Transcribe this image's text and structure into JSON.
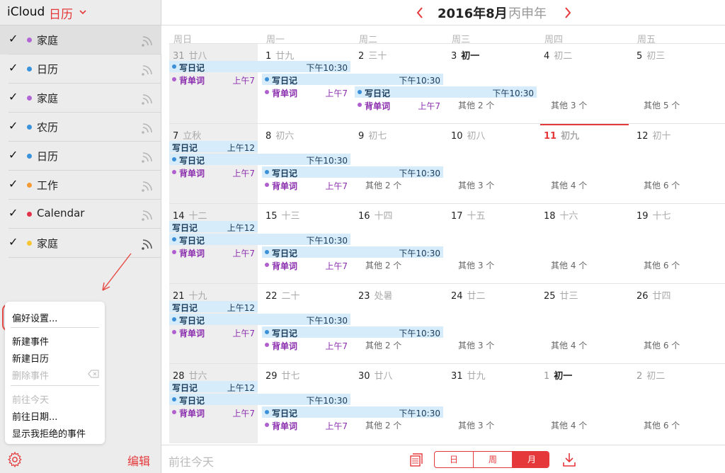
{
  "sidebar": {
    "icloud": "iCloud",
    "calendar_label": "日历",
    "calendars": [
      {
        "label": "家庭",
        "color": "#b266d6",
        "selected": true
      },
      {
        "label": "日历",
        "color": "#3b93dc",
        "selected": false
      },
      {
        "label": "家庭",
        "color": "#b266d6",
        "selected": false
      },
      {
        "label": "农历",
        "color": "#3b93dc",
        "selected": false
      },
      {
        "label": "日历",
        "color": "#3b93dc",
        "selected": false
      },
      {
        "label": "工作",
        "color": "#f39a34",
        "selected": false
      },
      {
        "label": "Calendar",
        "color": "#e3334a",
        "selected": false
      },
      {
        "label": "家庭",
        "color": "#f7c531",
        "selected": false
      }
    ],
    "edit": "编辑"
  },
  "menu": {
    "preferences": "偏好设置...",
    "new_event": "新建事件",
    "new_calendar": "新建日历",
    "delete_event": "删除事件",
    "goto_today": "前往今天",
    "goto_date": "前往日期...",
    "show_declined": "显示我拒绝的事件"
  },
  "header": {
    "month": "2016年8月",
    "lunar_year": "丙申年"
  },
  "weekdays": [
    "周日",
    "周一",
    "周二",
    "周三",
    "周四",
    "周五"
  ],
  "weeks": [
    [
      {
        "n": "31",
        "l": "廿八",
        "other": true
      },
      {
        "n": "1",
        "l": "廿九"
      },
      {
        "n": "2",
        "l": "三十"
      },
      {
        "n": "3",
        "l": "初一",
        "dark": true
      },
      {
        "n": "4",
        "l": "初二"
      },
      {
        "n": "5",
        "l": "初三"
      }
    ],
    [
      {
        "n": "7",
        "l": "立秋"
      },
      {
        "n": "8",
        "l": "初六"
      },
      {
        "n": "9",
        "l": "初七"
      },
      {
        "n": "10",
        "l": "初八"
      },
      {
        "n": "11",
        "l": "初九",
        "today": true
      },
      {
        "n": "12",
        "l": "初十"
      }
    ],
    [
      {
        "n": "14",
        "l": "十二"
      },
      {
        "n": "15",
        "l": "十三"
      },
      {
        "n": "16",
        "l": "十四"
      },
      {
        "n": "17",
        "l": "十五"
      },
      {
        "n": "18",
        "l": "十六"
      },
      {
        "n": "19",
        "l": "十七"
      }
    ],
    [
      {
        "n": "21",
        "l": "十九"
      },
      {
        "n": "22",
        "l": "二十"
      },
      {
        "n": "23",
        "l": "处暑"
      },
      {
        "n": "24",
        "l": "廿二"
      },
      {
        "n": "25",
        "l": "廿三"
      },
      {
        "n": "26",
        "l": "廿四"
      }
    ],
    [
      {
        "n": "28",
        "l": "廿六"
      },
      {
        "n": "29",
        "l": "廿七"
      },
      {
        "n": "30",
        "l": "廿八"
      },
      {
        "n": "31",
        "l": "廿九"
      },
      {
        "n": "1",
        "l": "初一",
        "other": true,
        "dark": true
      },
      {
        "n": "2",
        "l": "初二",
        "other": true
      }
    ]
  ],
  "events": {
    "diary": "写日记",
    "vocab": "背单词",
    "t1030": "下午10:30",
    "t7": "上午7",
    "t12": "上午12"
  },
  "more": {
    "w0": [
      "其他 2 个",
      "其他 3 个",
      "其他 5 个"
    ],
    "w1": [
      "其他 2 个",
      "其他 3 个",
      "其他 4 个",
      "其他 6 个"
    ],
    "w2": [
      "其他 2 个",
      "其他 3 个",
      "其他 4 个",
      "其他 6 个"
    ],
    "w3": [
      "其他 2 个",
      "其他 3 个",
      "其他 4 个",
      "其他 6 个"
    ],
    "w4": [
      "其他 2 个",
      "其他 3 个",
      "其他 4 个",
      "其他 6 个"
    ]
  },
  "bottom": {
    "goto_today": "前往今天",
    "day": "日",
    "week": "周",
    "month": "月"
  },
  "colors": {
    "accent": "#e5383b",
    "event_bg": "#d6ecfa",
    "vocab": "#8b2fae"
  }
}
